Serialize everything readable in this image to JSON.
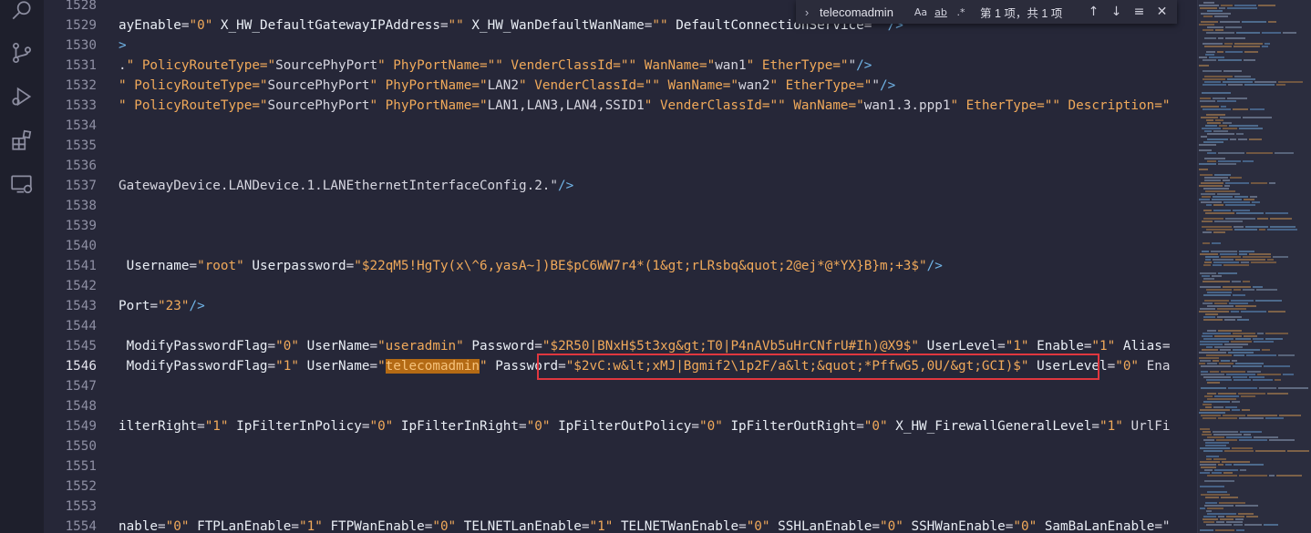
{
  "activity_bar": {
    "icons": [
      "search-icon",
      "source-control-icon",
      "run-debug-icon",
      "extensions-icon",
      "remote-explorer-icon"
    ]
  },
  "find": {
    "query": "telecomadmin",
    "opt_case": "Aa",
    "opt_word": "ab",
    "opt_regex": ".*",
    "count": "第 1 项，共 1 项",
    "prev_icon": "↑",
    "next_icon": "↓",
    "selection_icon": "≡",
    "close_icon": "✕",
    "toggle_icon": "›"
  },
  "lines": [
    {
      "num": "1528",
      "text": ""
    },
    {
      "num": "1529",
      "text": "ayEnable=\"0\" X_HW_DefaultGatewayIPAddress=\"\" X_HW_WanDefaultWanName=\"\" DefaultConnectionService=\"\"/>"
    },
    {
      "num": "1530",
      "text": ">"
    },
    {
      "num": "1531",
      "text": ".\" PolicyRouteType=\"SourcePhyPort\" PhyPortName=\"\" VenderClassId=\"\" WanName=\"wan1\" EtherType=\"\"/>"
    },
    {
      "num": "1532",
      "text": "\" PolicyRouteType=\"SourcePhyPort\" PhyPortName=\"LAN2\" VenderClassId=\"\" WanName=\"wan2\" EtherType=\"\"/>"
    },
    {
      "num": "1533",
      "text": "\" PolicyRouteType=\"SourcePhyPort\" PhyPortName=\"LAN1,LAN3,LAN4,SSID1\" VenderClassId=\"\" WanName=\"wan1.3.ppp1\" EtherType=\"\" Description=\""
    },
    {
      "num": "1534",
      "text": ""
    },
    {
      "num": "1535",
      "text": ""
    },
    {
      "num": "1536",
      "text": ""
    },
    {
      "num": "1537",
      "text": "GatewayDevice.LANDevice.1.LANEthernetInterfaceConfig.2.\"/>"
    },
    {
      "num": "1538",
      "text": ""
    },
    {
      "num": "1539",
      "text": ""
    },
    {
      "num": "1540",
      "text": ""
    },
    {
      "num": "1541",
      "text": " Username=\"root\" Userpassword=\"$22qM5!HgTy(x\\^6,yasA~])BE$pC6WW7r4*(1&gt;rLRsbq&quot;2@ej*@*YX}B}m;+3$\"/>"
    },
    {
      "num": "1542",
      "text": ""
    },
    {
      "num": "1543",
      "text": "Port=\"23\"/>"
    },
    {
      "num": "1544",
      "text": ""
    },
    {
      "num": "1545",
      "text": " ModifyPasswordFlag=\"0\" UserName=\"useradmin\" Password=\"$2R50|BNxH$5t3xg&gt;T0|P4nAVb5uHrCNfrU#Ih)@X9$\" UserLevel=\"1\" Enable=\"1\" Alias="
    },
    {
      "num": "1546",
      "text": " ModifyPasswordFlag=\"1\" UserName=\"telecomadmin\" Password=\"$2vC:w&lt;xMJ|Bgmif2\\1p2F/a&lt;&quot;*PffwG5,0U/&gt;GCI)$\" UserLevel=\"0\" Ena"
    },
    {
      "num": "1547",
      "text": ""
    },
    {
      "num": "1548",
      "text": ""
    },
    {
      "num": "1549",
      "text": "ilterRight=\"1\" IpFilterInPolicy=\"0\" IpFilterInRight=\"0\" IpFilterOutPolicy=\"0\" IpFilterOutRight=\"0\" X_HW_FirewallGeneralLevel=\"1\" UrlFi"
    },
    {
      "num": "1550",
      "text": ""
    },
    {
      "num": "1551",
      "text": ""
    },
    {
      "num": "1552",
      "text": ""
    },
    {
      "num": "1553",
      "text": ""
    },
    {
      "num": "1554",
      "text": "nable=\"0\" FTPLanEnable=\"1\" FTPWanEnable=\"0\" TELNETLanEnable=\"1\" TELNETWanEnable=\"0\" SSHLanEnable=\"0\" SSHWanEnable=\"0\" SamBaLanEnable=\""
    }
  ],
  "active_line": "1546",
  "highlight_term": "telecomadmin",
  "colors": {
    "background": "#262738",
    "attribute": "#e9eef5",
    "string": "#f0a95a",
    "match_highlight": "#b46a14",
    "annotation_box": "#e0373f"
  }
}
